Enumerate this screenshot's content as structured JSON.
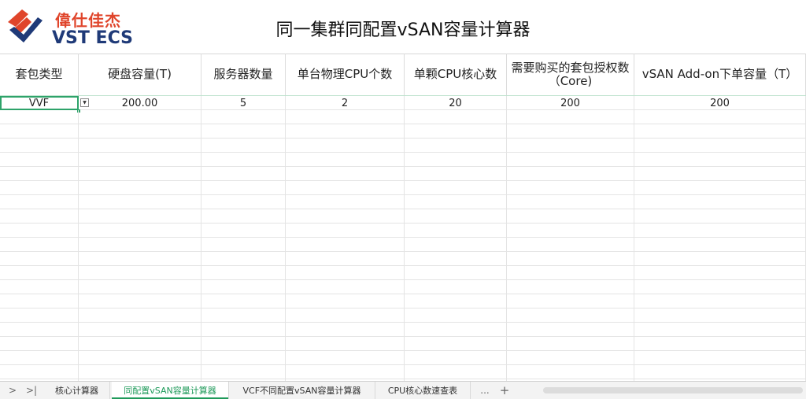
{
  "logo": {
    "cn_text": "偉仕佳杰",
    "en_text": "VST ECS",
    "brand_colors": {
      "red": "#e0452b",
      "blue": "#1f3a78"
    }
  },
  "title": "同一集群同配置vSAN容量计算器",
  "headers": [
    "套包类型",
    "硬盘容量(T)",
    "服务器数量",
    "单台物理CPU个数",
    "单颗CPU核心数",
    "需要购买的套包授权数（Core)",
    "vSAN Add-on下单容量（T）"
  ],
  "rows": [
    [
      "VVF",
      "200.00",
      "5",
      "2",
      "20",
      "200",
      "200"
    ]
  ],
  "tabs": [
    {
      "label": "核心计算器",
      "active": false
    },
    {
      "label": "同配置vSAN容量计算器",
      "active": true
    },
    {
      "label": "VCF不同配置vSAN容量计算器",
      "active": false
    },
    {
      "label": "CPU核心数速查表",
      "active": false
    }
  ],
  "tabbar": {
    "prev_icon": ">",
    "last_icon": ">|",
    "more_label": "...",
    "add_label": "+"
  },
  "accent_color": "#1f9a5a"
}
